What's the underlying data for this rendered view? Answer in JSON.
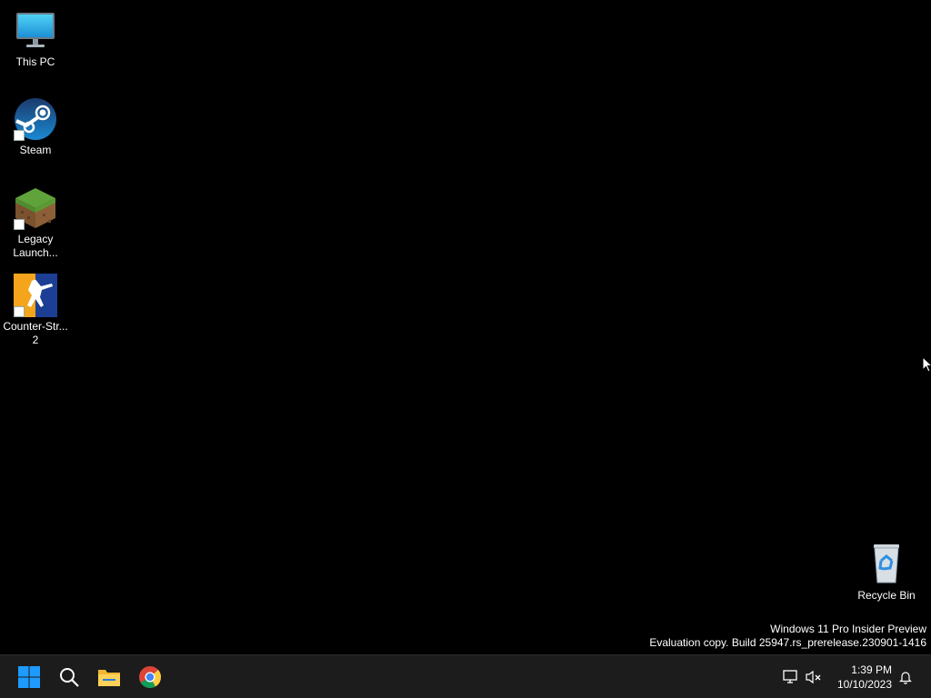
{
  "desktop": {
    "icons": [
      {
        "label": "This PC",
        "icon": "monitor-icon"
      },
      {
        "label": "Steam",
        "icon": "steam-icon"
      },
      {
        "label": "Legacy Launch...",
        "icon": "grass-block-icon"
      },
      {
        "label": "Counter-Str...\n2",
        "icon": "counter-strike-icon"
      },
      {
        "label": "Recycle Bin",
        "icon": "recycle-bin-icon"
      }
    ]
  },
  "watermark": {
    "line1": "Windows 11 Pro Insider Preview",
    "line2": "Evaluation copy. Build 25947.rs_prerelease.230901-1416"
  },
  "taskbar": {
    "buttons": [
      {
        "name": "start",
        "icon": "windows-logo-icon"
      },
      {
        "name": "search",
        "icon": "search-icon"
      },
      {
        "name": "file-explorer",
        "icon": "folder-icon"
      },
      {
        "name": "chrome",
        "icon": "chrome-icon"
      }
    ],
    "tray": {
      "time": "1:39 PM",
      "date": "10/10/2023"
    }
  },
  "colors": {
    "desktop_bg": "#000000",
    "taskbar_bg": "#1c1c1c",
    "windows_blue": "#1e90ff"
  }
}
